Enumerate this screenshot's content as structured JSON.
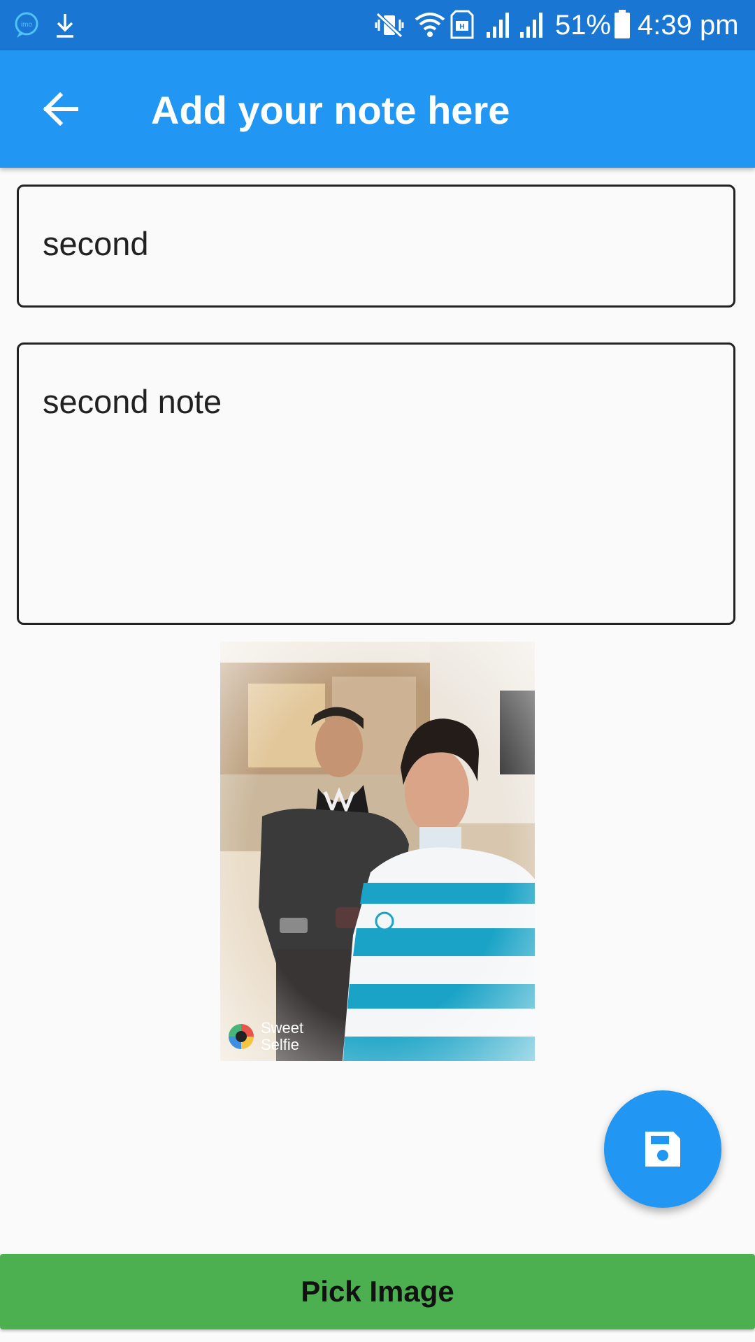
{
  "status_bar": {
    "battery_percent": "51%",
    "time": "4:39 pm",
    "icons": [
      "imo-icon",
      "download-icon",
      "vibrate-icon",
      "wifi-icon",
      "hd-icon",
      "signal-icon",
      "signal-icon",
      "battery-icon"
    ]
  },
  "app_bar": {
    "title": "Add your note here",
    "back_icon": "arrow-back-icon"
  },
  "form": {
    "title_value": "second",
    "note_value": "second note"
  },
  "image": {
    "watermark_line1": "Sweet",
    "watermark_line2": "Selfie"
  },
  "fab": {
    "icon": "save-icon"
  },
  "pick_button": {
    "label": "Pick Image"
  },
  "colors": {
    "status_bar": "#1976d2",
    "primary": "#2196f3",
    "accent_button": "#4caf50",
    "background": "#fafafa"
  }
}
